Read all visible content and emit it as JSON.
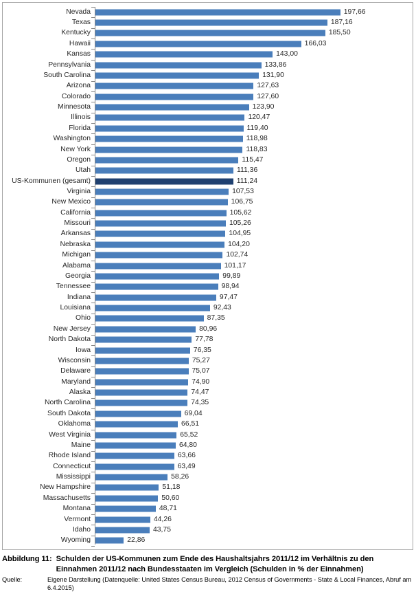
{
  "chart_data": {
    "type": "bar",
    "orientation": "horizontal",
    "title": "",
    "xlabel": "",
    "ylabel": "",
    "grid": false,
    "legend": false,
    "xlim": [
      0,
      210
    ],
    "value_format": "german-decimal-comma",
    "bar_color": "#4a7ebb",
    "highlight_color": "#1f4070",
    "highlight_category": "US-Kommunen (gesamt)",
    "categories": [
      "Nevada",
      "Texas",
      "Kentucky",
      "Hawaii",
      "Kansas",
      "Pennsylvania",
      "South Carolina",
      "Arizona",
      "Colorado",
      "Minnesota",
      "Illinois",
      "Florida",
      "Washington",
      "New York",
      "Oregon",
      "Utah",
      "US-Kommunen (gesamt)",
      "Virginia",
      "New Mexico",
      "California",
      "Missouri",
      "Arkansas",
      "Nebraska",
      "Michigan",
      "Alabama",
      "Georgia",
      "Tennessee",
      "Indiana",
      "Louisiana",
      "Ohio",
      "New Jersey",
      "North Dakota",
      "Iowa",
      "Wisconsin",
      "Delaware",
      "Maryland",
      "Alaska",
      "North Carolina",
      "South Dakota",
      "Oklahoma",
      "West Virginia",
      "Maine",
      "Rhode Island",
      "Connecticut",
      "Mississippi",
      "New Hampshire",
      "Massachusetts",
      "Montana",
      "Vermont",
      "Idaho",
      "Wyoming"
    ],
    "values": [
      197.66,
      187.16,
      185.5,
      166.03,
      143.0,
      133.86,
      131.9,
      127.63,
      127.6,
      123.9,
      120.47,
      119.4,
      118.98,
      118.83,
      115.47,
      111.36,
      111.24,
      107.53,
      106.75,
      105.62,
      105.26,
      104.95,
      104.2,
      102.74,
      101.17,
      99.89,
      98.94,
      97.47,
      92.43,
      87.35,
      80.96,
      77.78,
      76.35,
      75.27,
      75.07,
      74.9,
      74.47,
      74.35,
      69.04,
      66.51,
      65.52,
      64.8,
      63.66,
      63.49,
      58.26,
      51.18,
      50.6,
      48.71,
      44.26,
      43.75,
      22.86
    ],
    "value_labels": [
      "197,66",
      "187,16",
      "185,50",
      "166,03",
      "143,00",
      "133,86",
      "131,90",
      "127,63",
      "127,60",
      "123,90",
      "120,47",
      "119,40",
      "118,98",
      "118,83",
      "115,47",
      "111,36",
      "111,24",
      "107,53",
      "106,75",
      "105,62",
      "105,26",
      "104,95",
      "104,20",
      "102,74",
      "101,17",
      "99,89",
      "98,94",
      "97,47",
      "92,43",
      "87,35",
      "80,96",
      "77,78",
      "76,35",
      "75,27",
      "75,07",
      "74,90",
      "74,47",
      "74,35",
      "69,04",
      "66,51",
      "65,52",
      "64,80",
      "63,66",
      "63,49",
      "58,26",
      "51,18",
      "50,60",
      "48,71",
      "44,26",
      "43,75",
      "22,86"
    ]
  },
  "caption": {
    "figure_number": "Abbildung 11:",
    "figure_text": "Schulden der US-Kommunen zum Ende des Haushaltsjahrs 2011/12 im Verhältnis zu den Einnahmen 2011/12 nach Bundesstaaten im Vergleich (Schulden in % der Einnahmen)",
    "source_key": "Quelle:",
    "source_text": "Eigene Darstellung (Datenquelle: United States Census Bureau, 2012 Census of Governments - State & Local Finances, Abruf am 6.4.2015)"
  }
}
